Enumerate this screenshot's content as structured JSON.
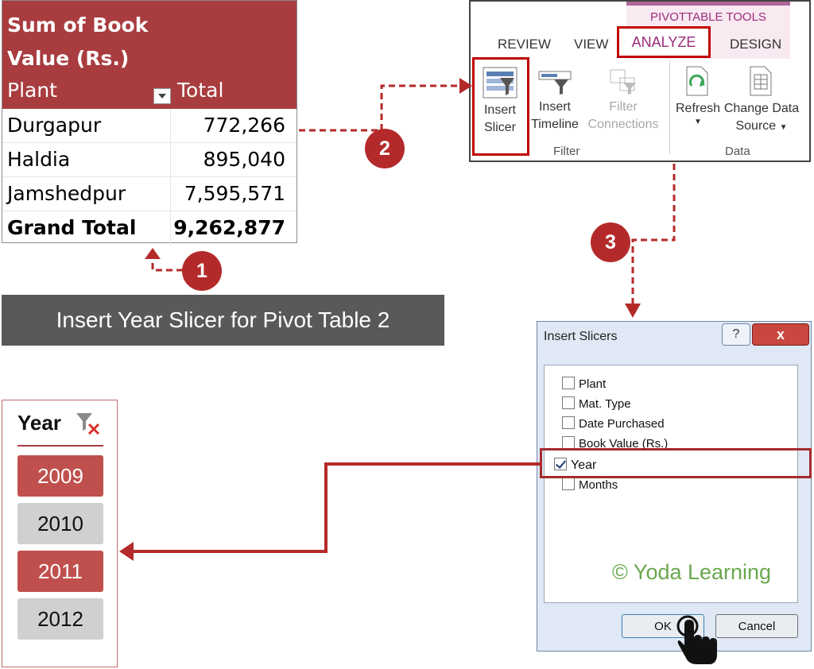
{
  "pivot": {
    "title": "Sum of Book Value (Rs.)",
    "col_plant": "Plant",
    "col_total": "Total",
    "rows": [
      {
        "plant": "Durgapur",
        "total": "772,266"
      },
      {
        "plant": "Haldia",
        "total": "895,040"
      },
      {
        "plant": "Jamshedpur",
        "total": "7,595,571"
      }
    ],
    "grand_total_label": "Grand Total",
    "grand_total_value": "9,262,877"
  },
  "banner": {
    "text": "Insert Year Slicer for Pivot Table 2"
  },
  "steps": {
    "one": "1",
    "two": "2",
    "three": "3"
  },
  "ribbon": {
    "context_label": "PIVOTTABLE TOOLS",
    "tabs": {
      "review": "REVIEW",
      "view": "VIEW",
      "analyze": "ANALYZE",
      "design": "DESIGN"
    },
    "buttons": {
      "insert_slicer": "Insert Slicer",
      "insert_timeline": "Insert Timeline",
      "filter_connections": "Filter Connections",
      "refresh": "Refresh",
      "change_data_source": "Change Data Source"
    },
    "groups": {
      "filter": "Filter",
      "data": "Data"
    },
    "accent": "#c00000"
  },
  "dialog": {
    "title": "Insert Slicers",
    "help": "?",
    "close": "x",
    "fields": [
      {
        "label": "Plant",
        "checked": false
      },
      {
        "label": "Mat. Type",
        "checked": false
      },
      {
        "label": "Date Purchased",
        "checked": false
      },
      {
        "label": "Book Value (Rs.)",
        "checked": false
      },
      {
        "label": "Year",
        "checked": true
      },
      {
        "label": "Months",
        "checked": false
      }
    ],
    "watermark": "© Yoda Learning",
    "ok": "OK",
    "cancel": "Cancel"
  },
  "slicer": {
    "title": "Year",
    "items": [
      {
        "label": "2009",
        "selected": true
      },
      {
        "label": "2010",
        "selected": false
      },
      {
        "label": "2011",
        "selected": true
      },
      {
        "label": "2012",
        "selected": false
      }
    ],
    "selected_color": "#c0504d",
    "unselected_color": "#d0d0d0"
  }
}
